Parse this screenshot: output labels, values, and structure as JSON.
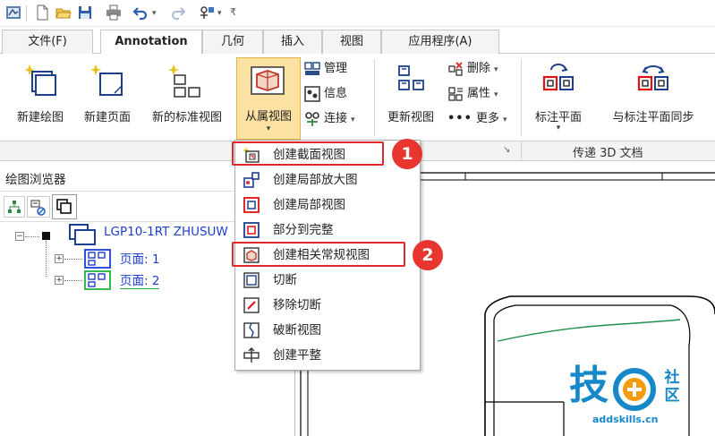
{
  "tabs": [
    {
      "label": "文件(F)"
    },
    {
      "label": "Annotation"
    },
    {
      "label": "几何"
    },
    {
      "label": "插入"
    },
    {
      "label": "视图"
    },
    {
      "label": "应用程序(A)"
    }
  ],
  "ribbon": {
    "new_drawing": "新建绘图",
    "new_page": "新建页面",
    "new_standard_view": "新的标准视图",
    "dependent_view": "从属视图",
    "manage": "管理",
    "info": "信息",
    "connect": "连接",
    "update_view": "更新视图",
    "delete": "删除",
    "properties": "属性",
    "more": "更多",
    "annotation_plane": "标注平面",
    "sync_annotation_plane": "与标注平面同步",
    "group_3d": "传递 3D 文档"
  },
  "browser": {
    "title": "绘图浏览器",
    "root": "LGP10-1RT ZHUSUW",
    "page1": "页面: 1",
    "page2": "页面: 2"
  },
  "menu": {
    "items": [
      {
        "label": "创建截面视图",
        "icon": "section-view-icon"
      },
      {
        "label": "创建局部放大图",
        "icon": "detail-view-icon"
      },
      {
        "label": "创建局部视图",
        "icon": "partial-view-icon"
      },
      {
        "label": "部分到完整",
        "icon": "partial-to-full-icon"
      },
      {
        "label": "创建相关常规视图",
        "icon": "related-view-icon"
      },
      {
        "label": "切断",
        "icon": "cut-icon"
      },
      {
        "label": "移除切断",
        "icon": "remove-cut-icon"
      },
      {
        "label": "破断视图",
        "icon": "broken-view-icon"
      },
      {
        "label": "创建平整",
        "icon": "flatten-icon"
      }
    ]
  },
  "callouts": {
    "one": "1",
    "two": "2"
  },
  "watermark": {
    "main": "技",
    "side": "社区",
    "url": "addskills.cn"
  },
  "colors": {
    "accent": "#e8352f",
    "link": "#1d3fd1",
    "watermark": "#1688c9"
  }
}
